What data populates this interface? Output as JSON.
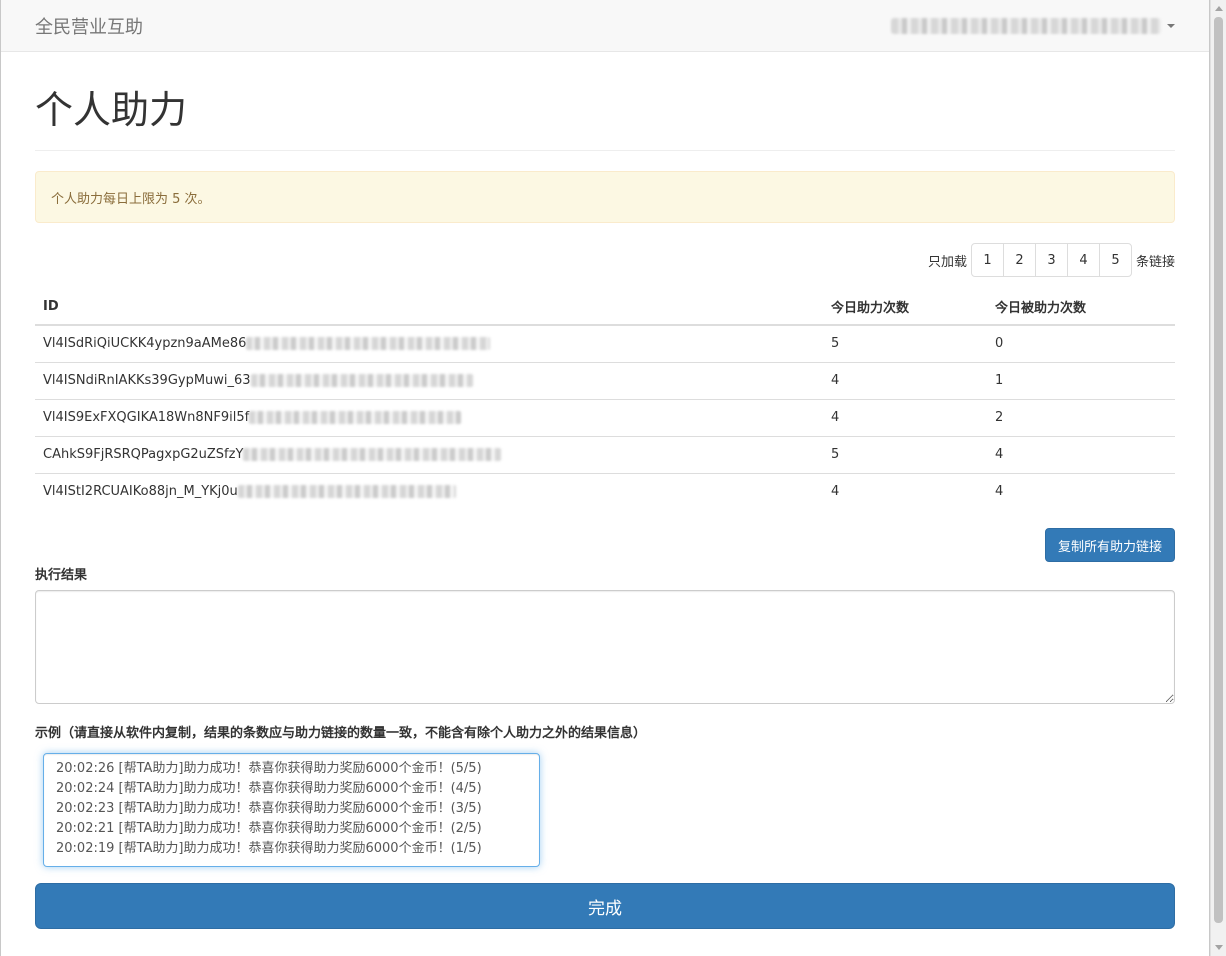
{
  "navbar": {
    "brand": "全民营业互助"
  },
  "page": {
    "title": "个人助力"
  },
  "alert": {
    "text": "个人助力每日上限为 5 次。"
  },
  "load": {
    "prefix": "只加载",
    "suffix": "条链接",
    "pages": [
      "1",
      "2",
      "3",
      "4",
      "5"
    ]
  },
  "table": {
    "headers": [
      "ID",
      "今日助力次数",
      "今日被助力次数"
    ],
    "rows": [
      {
        "id": "Vl4ISdRiQiUCKK4ypzn9aAMe86",
        "helped": "5",
        "received": "0"
      },
      {
        "id": "Vl4ISNdiRnIAKKs39GypMuwi_63",
        "helped": "4",
        "received": "1"
      },
      {
        "id": "Vl4IS9ExFXQGIKA18Wn8NF9il5f",
        "helped": "4",
        "received": "2"
      },
      {
        "id": "CAhkS9FjRSRQPagxpG2uZSfzY",
        "helped": "5",
        "received": "4"
      },
      {
        "id": "Vl4IStI2RCUAIKo88jn_M_YKj0u",
        "helped": "4",
        "received": "4"
      }
    ]
  },
  "copy_button": "复制所有助力链接",
  "result": {
    "label": "执行结果",
    "value": ""
  },
  "example": {
    "label": "示例（请直接从软件内复制，结果的条数应与助力链接的数量一致，不能含有除个人助力之外的结果信息）",
    "lines": [
      "20:02:26 [帮TA助力]助力成功！恭喜你获得助力奖励6000个金币！(5/5)",
      "20:02:24 [帮TA助力]助力成功！恭喜你获得助力奖励6000个金币！(4/5)",
      "20:02:23 [帮TA助力]助力成功！恭喜你获得助力奖励6000个金币！(3/5)",
      "20:02:21 [帮TA助力]助力成功！恭喜你获得助力奖励6000个金币！(2/5)",
      "20:02:19 [帮TA助力]助力成功！恭喜你获得助力奖励6000个金币！(1/5)"
    ]
  },
  "submit_button": "完成",
  "colors": {
    "primary": "#337ab7",
    "alert_bg": "#fcf8e3",
    "alert_text": "#8a6d3b"
  }
}
